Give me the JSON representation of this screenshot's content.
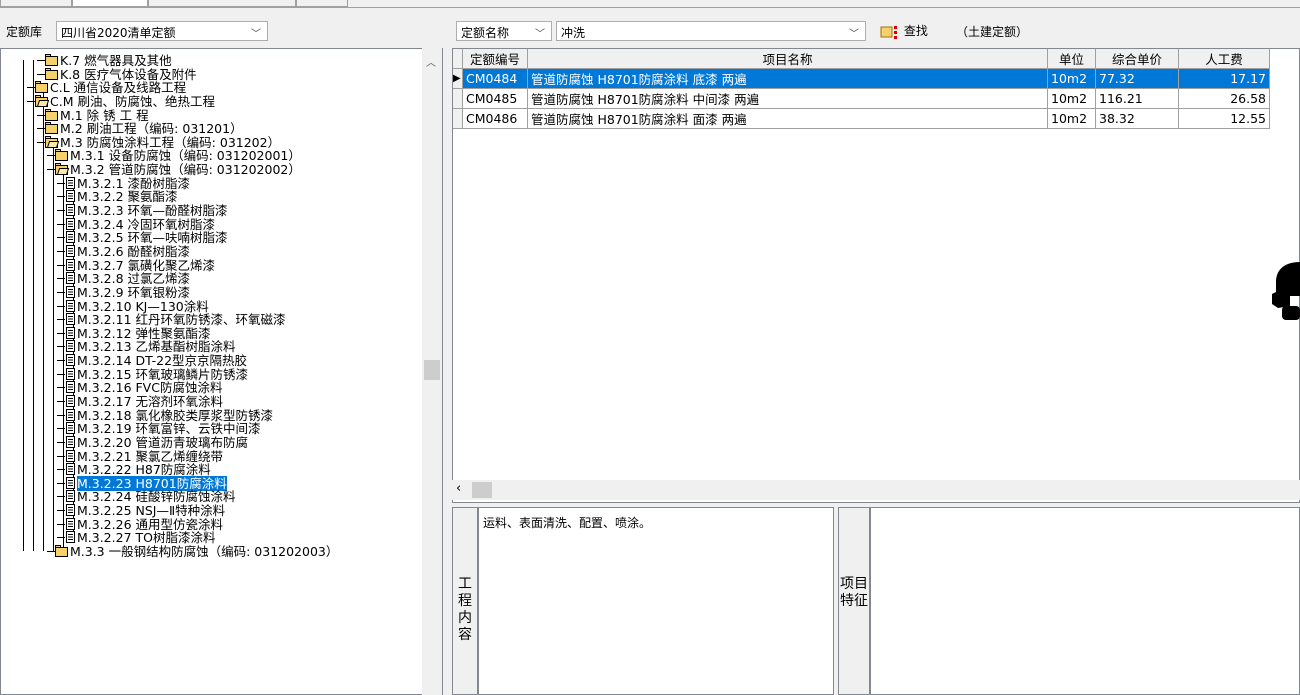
{
  "toolbar": {
    "library_label": "定额库",
    "library_value": "四川省2020清单定额",
    "search_field_value": "定额名称",
    "search_text": "冲洗",
    "find_label": "查找",
    "scope_label": "（土建定额）"
  },
  "tree": {
    "nodes": [
      {
        "label": "K.7 燃气器具及其他",
        "icon": "folder-icon"
      },
      {
        "label": "K.8 医疗气体设备及附件",
        "icon": "folder-icon"
      },
      {
        "label": "C.L 通信设备及线路工程",
        "icon": "folder-icon"
      },
      {
        "label": "C.M 刷油、防腐蚀、绝热工程",
        "icon": "folder-open-icon"
      },
      {
        "label": "M.1 除 锈 工 程",
        "icon": "folder-icon"
      },
      {
        "label": "M.2 刷油工程（编码: 031201）",
        "icon": "folder-icon"
      },
      {
        "label": "M.3 防腐蚀涂料工程（编码: 031202）",
        "icon": "folder-open-icon"
      },
      {
        "label": "M.3.1 设备防腐蚀（编码: 031202001）",
        "icon": "folder-icon"
      },
      {
        "label": "M.3.2 管道防腐蚀（编码: 031202002）",
        "icon": "folder-open-icon"
      },
      {
        "label": "M.3.2.1 漆酚树脂漆",
        "icon": "document-icon"
      },
      {
        "label": "M.3.2.2 聚氨酯漆",
        "icon": "document-icon"
      },
      {
        "label": "M.3.2.3 环氧—酚醛树脂漆",
        "icon": "document-icon"
      },
      {
        "label": "M.3.2.4 冷固环氧树脂漆",
        "icon": "document-icon"
      },
      {
        "label": "M.3.2.5 环氧—呋喃树脂漆",
        "icon": "document-icon"
      },
      {
        "label": "M.3.2.6 酚醛树脂漆",
        "icon": "document-icon"
      },
      {
        "label": "M.3.2.7 氯磺化聚乙烯漆",
        "icon": "document-icon"
      },
      {
        "label": "M.3.2.8 过氯乙烯漆",
        "icon": "document-icon"
      },
      {
        "label": "M.3.2.9 环氧银粉漆",
        "icon": "document-icon"
      },
      {
        "label": "M.3.2.10 KJ—130涂料",
        "icon": "document-icon"
      },
      {
        "label": "M.3.2.11 红丹环氧防锈漆、环氧磁漆",
        "icon": "document-icon"
      },
      {
        "label": "M.3.2.12 弹性聚氨酯漆",
        "icon": "document-icon"
      },
      {
        "label": "M.3.2.13 乙烯基酯树脂涂料",
        "icon": "document-icon"
      },
      {
        "label": "M.3.2.14 DT-22型京京隔热胶",
        "icon": "document-icon"
      },
      {
        "label": "M.3.2.15 环氧玻璃鳞片防锈漆",
        "icon": "document-icon"
      },
      {
        "label": "M.3.2.16 FVC防腐蚀涂料",
        "icon": "document-icon"
      },
      {
        "label": "M.3.2.17 无溶剂环氧涂料",
        "icon": "document-icon"
      },
      {
        "label": "M.3.2.18 氯化橡胶类厚浆型防锈漆",
        "icon": "document-icon"
      },
      {
        "label": "M.3.2.19 环氧富锌、云铁中间漆",
        "icon": "document-icon"
      },
      {
        "label": "M.3.2.20 管道沥青玻璃布防腐",
        "icon": "document-icon"
      },
      {
        "label": "M.3.2.21 聚氯乙烯缠绕带",
        "icon": "document-icon"
      },
      {
        "label": "M.3.2.22 H87防腐涂料",
        "icon": "document-icon"
      },
      {
        "label": "M.3.2.23 H8701防腐涂料",
        "icon": "document-icon"
      },
      {
        "label": "M.3.2.24 硅酸锌防腐蚀涂料",
        "icon": "document-icon"
      },
      {
        "label": "M.3.2.25 NSJ—Ⅱ特种涂料",
        "icon": "document-icon"
      },
      {
        "label": "M.3.2.26 通用型仿瓷涂料",
        "icon": "document-icon"
      },
      {
        "label": "M.3.2.27 TO树脂漆涂料",
        "icon": "document-icon"
      },
      {
        "label": "M.3.3 一般钢结构防腐蚀（编码: 031202003）",
        "icon": "folder-icon"
      }
    ]
  },
  "grid": {
    "headers": [
      "定额编号",
      "项目名称",
      "单位",
      "综合单价",
      "人工费"
    ],
    "rows": [
      {
        "code": "CM0484",
        "name": "管道防腐蚀 H8701防腐涂料 底漆 两遍",
        "unit": "10m2",
        "price": "77.32",
        "labor": "17.17"
      },
      {
        "code": "CM0485",
        "name": "管道防腐蚀 H8701防腐涂料 中间漆 两遍",
        "unit": "10m2",
        "price": "116.21",
        "labor": "26.58"
      },
      {
        "code": "CM0486",
        "name": "管道防腐蚀 H8701防腐涂料 面漆 两遍",
        "unit": "10m2",
        "price": "38.32",
        "labor": "12.55"
      }
    ]
  },
  "bottom": {
    "work_content_label": "工程内容",
    "work_content_text": "运料、表面清洗、配置、喷涂。",
    "features_label": "项目特征"
  },
  "colors": {
    "selection": "#0078d7",
    "folder": "#f5d06b"
  }
}
